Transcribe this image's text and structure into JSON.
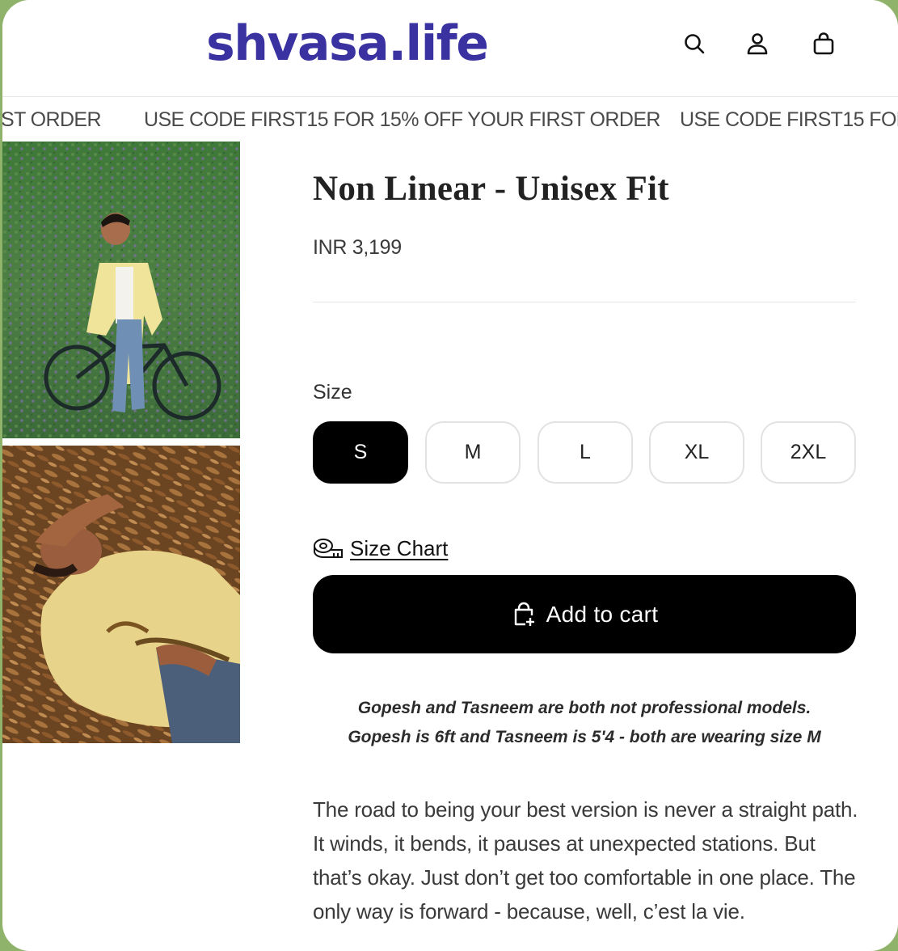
{
  "header": {
    "logo": "shvasa.life",
    "icons": [
      "search-icon",
      "account-icon",
      "cart-icon"
    ]
  },
  "announcement": {
    "text": "USE CODE FIRST15 FOR 15% OFF YOUR FIRST ORDER",
    "left_fragment": "ST ORDER",
    "right_fragment": "USE CODE FIRST15 FOR"
  },
  "product": {
    "title": "Non Linear - Unisex Fit",
    "price": "INR 3,199",
    "size_label": "Size",
    "sizes": [
      "S",
      "M",
      "L",
      "XL",
      "2XL"
    ],
    "selected_size": "S",
    "size_chart_label": "Size Chart",
    "add_to_cart_label": "Add to cart",
    "note_line1": "Gopesh and Tasneem are both not professional models.",
    "note_line2": "Gopesh is 6ft and Tasneem is 5'4 - both are wearing size M",
    "description": "The road to being your best version is never a straight path. It winds, it bends, it pauses at unexpected stations. But that’s okay. Just don’t get too comfortable in one place. The only way is forward - because, well, c’est la vie."
  },
  "colors": {
    "brand": "#3a32a0",
    "button": "#000000",
    "border": "#e2e2e2"
  }
}
